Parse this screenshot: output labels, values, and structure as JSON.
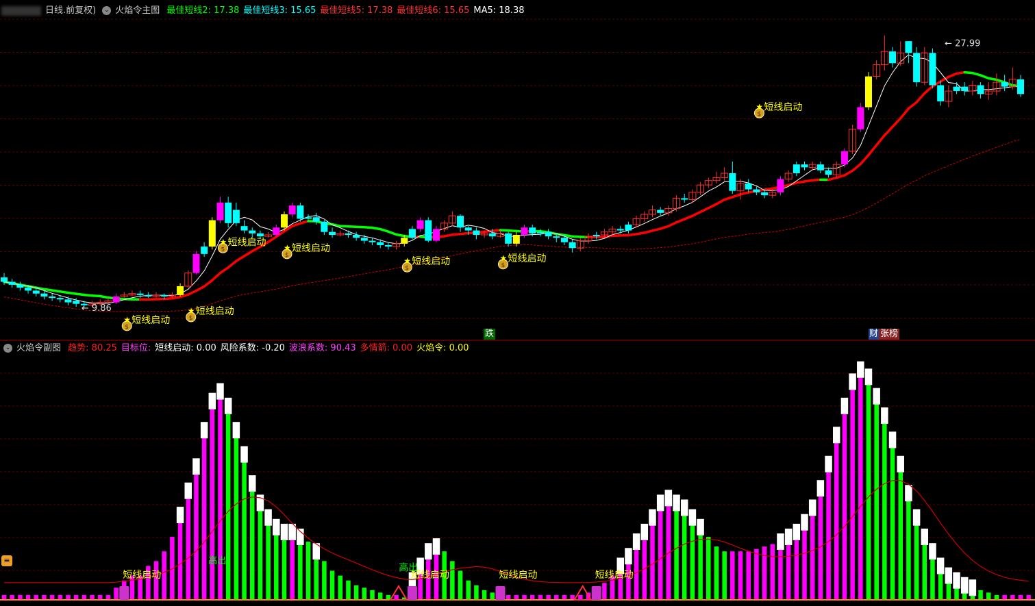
{
  "main_header": {
    "period": "日线.前复权)",
    "title": "火焰令主图",
    "items": [
      {
        "label": "最佳短线2: 17.38",
        "color": "#00ff00"
      },
      {
        "label": "最佳短线3: 15.65",
        "color": "#00ffff"
      },
      {
        "label": "最佳短线5: 17.38",
        "color": "#ff3333"
      },
      {
        "label": "最佳短线6: 15.65",
        "color": "#ff3333"
      },
      {
        "label": "MA5: 18.38",
        "color": "#ffffff"
      }
    ]
  },
  "sub_header": {
    "title": "火焰令副图",
    "items": [
      {
        "label": "趋势: 80.25",
        "color": "#ff2020"
      },
      {
        "label": "目标位:",
        "color": "#ff40ff"
      },
      {
        "label": "短线启动: 0.00",
        "color": "#ffffff"
      },
      {
        "label": "风险系数: -0.20",
        "color": "#ffffff"
      },
      {
        "label": "波浪系数: 90.43",
        "color": "#ff40ff"
      },
      {
        "label": "多情箭: 0.00",
        "color": "#ff2020"
      },
      {
        "label": "火焰令: 0.00",
        "color": "#ffff00"
      }
    ]
  },
  "price_high_label": "27.99",
  "price_low_label": "9.86",
  "signal_label": "短线启动",
  "sub_signal_label": "短线启动",
  "gao_chu_label": "高出",
  "die_label": "跌",
  "cai_label": "财",
  "zhang_label": "张榜",
  "colors": {
    "up": "#ff3030",
    "down": "#00ffff",
    "ma_red": "#ff0000",
    "ma_green": "#00ff00",
    "magenta": "#ff00ff",
    "green": "#00ff00",
    "yellow": "#ffff00"
  },
  "chart_data": [
    {
      "type": "candlestick",
      "ylim": [
        8.5,
        29.5
      ],
      "grid": true,
      "candles": [
        [
          11.9,
          11.6,
          12.2,
          11.4,
          "d"
        ],
        [
          11.6,
          11.4,
          11.8,
          11.2,
          "d"
        ],
        [
          11.4,
          11.2,
          11.6,
          11.0,
          "d"
        ],
        [
          11.2,
          11.0,
          11.4,
          10.8,
          "d"
        ],
        [
          11.0,
          10.8,
          11.2,
          10.6,
          "d"
        ],
        [
          10.8,
          10.6,
          11.0,
          10.4,
          "d"
        ],
        [
          10.6,
          10.5,
          10.8,
          10.3,
          "d"
        ],
        [
          10.5,
          10.4,
          10.7,
          10.2,
          "d"
        ],
        [
          10.4,
          10.2,
          10.6,
          10.0,
          "d"
        ],
        [
          10.3,
          10.1,
          10.5,
          9.9,
          "d"
        ],
        [
          10.1,
          10.0,
          10.3,
          9.86,
          "d"
        ],
        [
          10.0,
          10.1,
          10.3,
          9.9,
          "u"
        ],
        [
          10.1,
          10.2,
          10.4,
          10.0,
          "u"
        ],
        [
          10.2,
          10.3,
          10.5,
          10.1,
          "u"
        ],
        [
          10.2,
          10.6,
          10.8,
          10.1,
          "m"
        ],
        [
          10.6,
          10.7,
          10.9,
          10.5,
          "u"
        ],
        [
          10.7,
          10.8,
          11.0,
          10.6,
          "u"
        ],
        [
          10.8,
          10.7,
          11.0,
          10.5,
          "d"
        ],
        [
          10.7,
          10.6,
          10.9,
          10.5,
          "d"
        ],
        [
          10.6,
          10.7,
          10.9,
          10.5,
          "u"
        ],
        [
          10.7,
          10.6,
          10.8,
          10.4,
          "d"
        ],
        [
          10.6,
          10.7,
          10.9,
          10.5,
          "u"
        ],
        [
          10.7,
          11.3,
          11.5,
          10.6,
          "y"
        ],
        [
          11.3,
          12.2,
          12.4,
          11.2,
          "u"
        ],
        [
          12.2,
          13.5,
          13.7,
          12.1,
          "m"
        ],
        [
          13.5,
          14.0,
          14.3,
          13.3,
          "d"
        ],
        [
          14.0,
          15.8,
          16.0,
          13.8,
          "y"
        ],
        [
          15.8,
          17.0,
          17.4,
          15.6,
          "m"
        ],
        [
          17.0,
          15.6,
          17.4,
          15.3,
          "d"
        ],
        [
          15.6,
          16.5,
          17.0,
          15.4,
          "d"
        ],
        [
          15.4,
          15.1,
          15.8,
          14.9,
          "d"
        ],
        [
          15.1,
          14.9,
          15.3,
          14.6,
          "d"
        ],
        [
          14.9,
          14.7,
          15.1,
          14.5,
          "d"
        ],
        [
          14.7,
          14.8,
          15.0,
          14.6,
          "u"
        ],
        [
          14.8,
          15.3,
          15.5,
          14.7,
          "m"
        ],
        [
          15.3,
          16.2,
          16.4,
          15.1,
          "y"
        ],
        [
          16.2,
          16.8,
          17.0,
          16.0,
          "m"
        ],
        [
          16.8,
          15.9,
          17.0,
          15.7,
          "d"
        ],
        [
          15.9,
          16.0,
          16.2,
          15.8,
          "d"
        ],
        [
          16.0,
          15.7,
          16.3,
          15.5,
          "d"
        ],
        [
          15.7,
          15.0,
          15.8,
          14.8,
          "d"
        ],
        [
          15.0,
          14.8,
          15.3,
          14.6,
          "d"
        ],
        [
          14.8,
          14.9,
          15.1,
          14.7,
          "u"
        ],
        [
          14.9,
          14.8,
          15.1,
          14.6,
          "d"
        ],
        [
          14.8,
          14.6,
          15.0,
          14.4,
          "d"
        ],
        [
          14.6,
          14.4,
          14.8,
          14.2,
          "d"
        ],
        [
          14.4,
          14.3,
          14.6,
          14.1,
          "d"
        ],
        [
          14.3,
          14.1,
          14.5,
          13.9,
          "d"
        ],
        [
          14.1,
          14.0,
          14.3,
          13.8,
          "d"
        ],
        [
          14.0,
          14.2,
          14.4,
          13.8,
          "u"
        ],
        [
          14.2,
          14.6,
          14.8,
          14.0,
          "y"
        ],
        [
          14.6,
          15.2,
          15.4,
          14.5,
          "d"
        ],
        [
          15.2,
          15.8,
          16.0,
          15.0,
          "m"
        ],
        [
          15.8,
          14.4,
          16.0,
          14.3,
          "d"
        ],
        [
          14.4,
          15.2,
          15.4,
          14.3,
          "m"
        ],
        [
          15.2,
          15.6,
          15.8,
          15.0,
          "u"
        ],
        [
          15.6,
          16.1,
          16.4,
          15.4,
          "u"
        ],
        [
          16.1,
          15.3,
          16.2,
          15.0,
          "d"
        ],
        [
          15.3,
          15.1,
          15.4,
          14.8,
          "d"
        ],
        [
          15.1,
          14.8,
          15.3,
          14.5,
          "d"
        ],
        [
          14.8,
          14.9,
          15.1,
          14.6,
          "u"
        ],
        [
          14.9,
          14.7,
          15.2,
          14.5,
          "d"
        ],
        [
          14.7,
          14.9,
          15.1,
          14.6,
          "u"
        ],
        [
          14.9,
          14.2,
          15.0,
          14.0,
          "d"
        ],
        [
          14.2,
          14.8,
          15.0,
          14.0,
          "y"
        ],
        [
          14.8,
          15.3,
          15.5,
          14.6,
          "m"
        ],
        [
          15.3,
          14.9,
          15.5,
          14.7,
          "d"
        ],
        [
          14.9,
          15.0,
          15.2,
          14.7,
          "d"
        ],
        [
          15.0,
          14.7,
          15.2,
          14.5,
          "d"
        ],
        [
          14.7,
          14.6,
          14.9,
          14.3,
          "d"
        ],
        [
          14.6,
          14.3,
          14.8,
          14.1,
          "d"
        ],
        [
          14.3,
          13.9,
          14.5,
          13.6,
          "d"
        ],
        [
          13.9,
          14.4,
          14.6,
          13.7,
          "u"
        ],
        [
          14.4,
          14.7,
          14.9,
          14.2,
          "u"
        ],
        [
          14.7,
          14.8,
          15.0,
          14.5,
          "d"
        ],
        [
          14.8,
          15.0,
          15.2,
          14.6,
          "u"
        ],
        [
          15.0,
          15.2,
          15.4,
          14.8,
          "u"
        ],
        [
          15.2,
          15.1,
          15.4,
          14.9,
          "d"
        ],
        [
          15.1,
          15.5,
          15.7,
          14.9,
          "d"
        ],
        [
          15.5,
          15.9,
          16.1,
          15.3,
          "u"
        ],
        [
          15.9,
          16.2,
          16.4,
          15.7,
          "u"
        ],
        [
          16.2,
          16.5,
          16.8,
          16.0,
          "u"
        ],
        [
          16.5,
          16.3,
          16.7,
          16.1,
          "d"
        ],
        [
          16.3,
          16.6,
          16.8,
          16.1,
          "u"
        ],
        [
          16.6,
          17.3,
          17.5,
          16.4,
          "u"
        ],
        [
          17.3,
          17.2,
          17.6,
          17.0,
          "d"
        ],
        [
          17.2,
          17.7,
          17.9,
          17.0,
          "u"
        ],
        [
          17.7,
          18.2,
          18.4,
          17.5,
          "u"
        ],
        [
          18.2,
          18.5,
          18.7,
          18.0,
          "u"
        ],
        [
          18.5,
          18.7,
          19.1,
          18.3,
          "u"
        ],
        [
          18.7,
          19.0,
          19.4,
          18.5,
          "u"
        ],
        [
          19.0,
          17.8,
          19.8,
          17.6,
          "d"
        ],
        [
          17.8,
          18.3,
          18.6,
          17.2,
          "u"
        ],
        [
          18.3,
          17.9,
          18.6,
          17.7,
          "d"
        ],
        [
          17.9,
          17.7,
          18.1,
          17.5,
          "d"
        ],
        [
          17.7,
          17.5,
          17.9,
          17.3,
          "d"
        ],
        [
          17.5,
          17.7,
          17.9,
          17.3,
          "u"
        ],
        [
          17.7,
          18.6,
          18.8,
          17.5,
          "m"
        ],
        [
          18.6,
          19.0,
          19.2,
          18.4,
          "u"
        ],
        [
          19.0,
          19.6,
          19.8,
          18.8,
          "d"
        ],
        [
          19.6,
          19.4,
          19.8,
          19.2,
          "d"
        ],
        [
          19.4,
          19.6,
          19.8,
          19.2,
          "u"
        ],
        [
          19.6,
          19.2,
          19.8,
          19.0,
          "d"
        ],
        [
          19.2,
          18.9,
          19.4,
          18.7,
          "d"
        ],
        [
          18.9,
          19.6,
          19.8,
          18.7,
          "u"
        ],
        [
          19.6,
          20.5,
          20.7,
          19.4,
          "m"
        ],
        [
          20.5,
          22.0,
          22.3,
          20.3,
          "u"
        ],
        [
          22.0,
          23.5,
          23.8,
          21.8,
          "m"
        ],
        [
          23.5,
          25.6,
          25.9,
          23.3,
          "y"
        ],
        [
          25.6,
          26.4,
          26.7,
          25.4,
          "u"
        ],
        [
          26.4,
          27.3,
          28.4,
          26.0,
          "u"
        ],
        [
          27.3,
          26.5,
          27.6,
          26.2,
          "d"
        ],
        [
          26.5,
          27.2,
          27.99,
          26.3,
          "u"
        ],
        [
          27.2,
          28.0,
          27.99,
          26.5,
          "d"
        ],
        [
          27.2,
          25.2,
          27.6,
          24.9,
          "d"
        ],
        [
          25.2,
          27.2,
          27.6,
          25.0,
          "u"
        ],
        [
          27.2,
          25.0,
          27.5,
          24.8,
          "d"
        ],
        [
          25.0,
          23.9,
          25.3,
          23.6,
          "d"
        ],
        [
          23.9,
          24.6,
          25.0,
          23.5,
          "u"
        ],
        [
          24.6,
          24.9,
          25.2,
          24.4,
          "d"
        ],
        [
          24.9,
          24.6,
          25.2,
          24.3,
          "d"
        ],
        [
          24.6,
          25.0,
          25.3,
          24.3,
          "u"
        ],
        [
          25.0,
          24.4,
          25.2,
          24.1,
          "d"
        ],
        [
          24.4,
          24.6,
          25.2,
          24.0,
          "u"
        ],
        [
          24.6,
          25.2,
          25.8,
          24.3,
          "u"
        ],
        [
          25.2,
          24.9,
          25.7,
          24.6,
          "d"
        ],
        [
          24.9,
          25.4,
          26.2,
          24.7,
          "u"
        ],
        [
          25.4,
          24.4,
          25.7,
          24.2,
          "d"
        ]
      ],
      "signals": [
        15,
        23,
        27,
        35,
        50,
        62
      ],
      "signals_low_price": [
        10.0,
        10.6,
        15.3,
        14.9,
        14.0,
        14.2
      ],
      "late_signal": 94,
      "late_signal_price": 24.5
    },
    {
      "type": "bar",
      "ylim": [
        0,
        100
      ],
      "values": [
        2,
        2,
        2,
        2,
        2,
        2,
        2,
        2,
        2,
        2,
        2,
        2,
        2,
        2,
        5,
        8,
        10,
        10,
        14,
        16,
        20,
        26,
        35,
        45,
        55,
        70,
        82,
        86,
        80,
        70,
        60,
        48,
        40,
        34,
        30,
        28,
        28,
        26,
        24,
        20,
        16,
        12,
        10,
        8,
        6,
        5,
        4,
        3,
        2,
        2,
        1,
        8,
        14,
        20,
        22,
        20,
        16,
        12,
        8,
        6,
        4,
        3,
        2,
        2,
        2,
        2,
        2,
        2,
        2,
        2,
        2,
        2,
        2,
        3,
        5,
        7,
        10,
        14,
        18,
        24,
        28,
        34,
        40,
        42,
        40,
        38,
        34,
        30,
        26,
        22,
        20,
        20,
        20,
        20,
        21,
        22,
        23,
        24,
        26,
        28,
        32,
        38,
        46,
        56,
        68,
        80,
        90,
        95,
        92,
        84,
        76,
        66,
        56,
        44,
        34,
        26,
        20,
        14,
        10,
        8,
        6,
        5,
        4,
        3,
        2,
        2,
        2,
        2,
        2
      ],
      "white_tips": [
        22,
        23,
        24,
        25,
        26,
        27,
        28,
        29,
        30,
        31,
        32,
        33,
        34,
        35,
        36,
        37,
        39,
        51,
        52,
        53,
        54,
        77,
        78,
        79,
        80,
        81,
        82,
        83,
        84,
        85,
        86,
        87,
        97,
        98,
        99,
        100,
        101,
        102,
        103,
        104,
        105,
        106,
        107,
        108,
        109,
        110,
        111,
        112,
        113,
        114,
        115,
        116,
        117,
        118,
        119,
        120,
        121,
        122,
        123,
        124,
        125,
        126,
        127,
        128
      ]
    }
  ]
}
